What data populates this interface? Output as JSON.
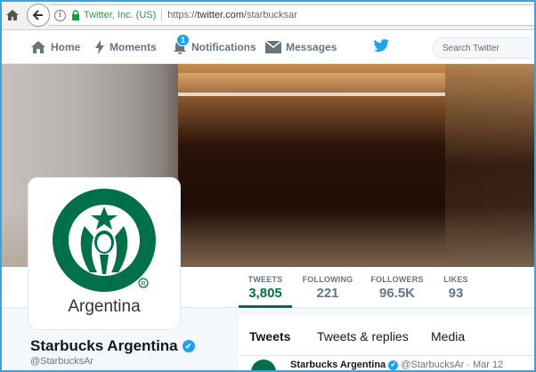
{
  "browser": {
    "cert_label": "Twitter, Inc. (US)",
    "url_scheme": "https://",
    "url_host": "twitter.com",
    "url_path": "/starbucksar",
    "icons": [
      "home-icon",
      "back-arrow-icon",
      "info-icon",
      "lock-icon"
    ]
  },
  "nav": {
    "home": "Home",
    "moments": "Moments",
    "notifications": "Notifications",
    "notifications_badge": "1",
    "messages": "Messages",
    "search_placeholder": "Search Twitter"
  },
  "profile": {
    "logo_text": "Argentina",
    "name": "Starbucks Argentina",
    "handle": "@StarbucksAr",
    "verified": "✔"
  },
  "stats": [
    {
      "label": "TWEETS",
      "value": "3,805"
    },
    {
      "label": "FOLLOWING",
      "value": "221"
    },
    {
      "label": "FOLLOWERS",
      "value": "96.5K"
    },
    {
      "label": "LIKES",
      "value": "93"
    }
  ],
  "tabs": [
    "Tweets",
    "Tweets & replies",
    "Media"
  ],
  "tweet": {
    "author": "Starbucks Argentina",
    "handle": "@StarbucksAr",
    "separator": "·",
    "date": "Mar 12"
  },
  "colors": {
    "twitter_blue": "#1da1f2",
    "starbucks_green": "#00704a",
    "secure_green": "#1f9b3b"
  }
}
